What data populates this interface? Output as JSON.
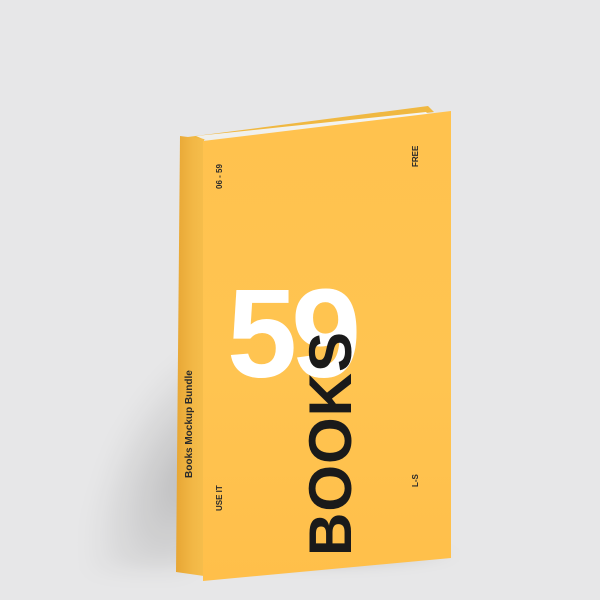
{
  "book": {
    "cover_color": "#ffc24e",
    "spine_color": "#f2b745",
    "number": "59",
    "title": "BOOKS",
    "top_left_label": "06 - 59",
    "top_right_label": "FREE",
    "bottom_left_label": "USE IT",
    "bottom_right_label": "L-S",
    "spine_label": "Books Mockup Bundle"
  }
}
